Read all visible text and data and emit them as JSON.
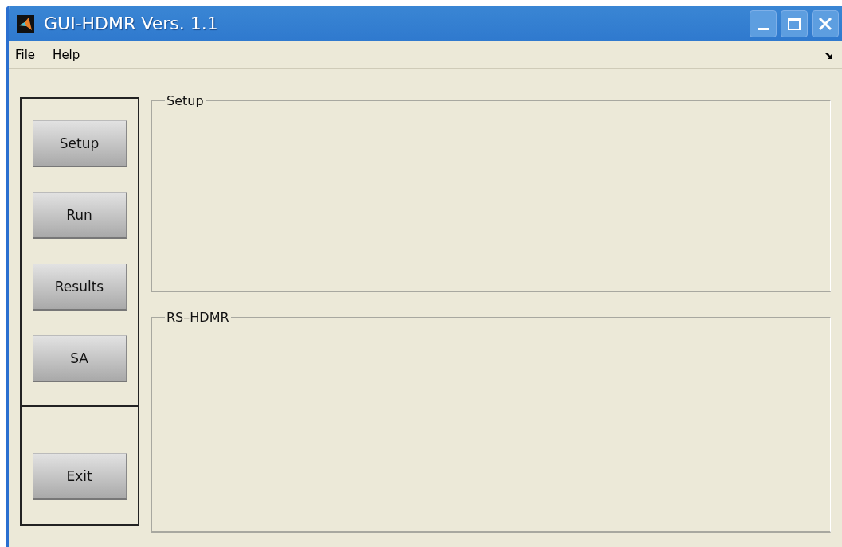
{
  "window": {
    "title": "GUI-HDMR Vers. 1.1"
  },
  "menu": [
    "File",
    "Help"
  ],
  "nav_buttons": [
    "Setup",
    "Run",
    "Results",
    "SA"
  ],
  "exit_button": "Exit",
  "panels": [
    {
      "title": "Setup"
    },
    {
      "title": "RS–HDMR"
    }
  ]
}
